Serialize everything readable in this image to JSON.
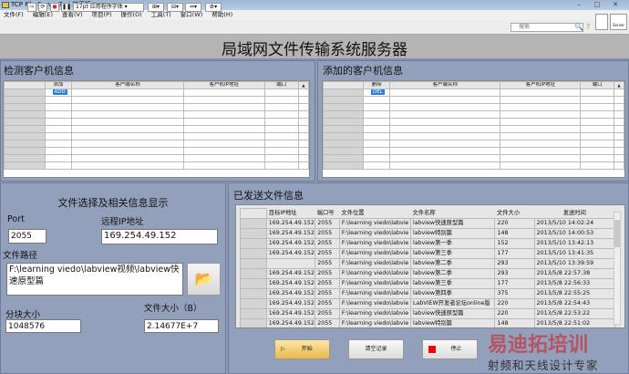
{
  "window": {
    "title": "TCP File Server7.vi 前面板 *",
    "minimize": "–",
    "maximize": "□",
    "close": "✕"
  },
  "menu": [
    "文件(F)",
    "编辑(E)",
    "查看(V)",
    "项目(P)",
    "操作(O)",
    "工具(T)",
    "窗口(W)",
    "帮助(H)"
  ],
  "toolbar": {
    "font": "17pt 应用程序字体",
    "search_placeholder": "搜索",
    "help": "?",
    "server_label": "Server"
  },
  "header": {
    "title": "局域网文件传输系统服务器"
  },
  "detected": {
    "title": "检测客户机信息",
    "columns": [
      "添加",
      "客户端名称",
      "客户机IP地址",
      "端口"
    ],
    "button": "ADD"
  },
  "added": {
    "title": "添加的客户机信息",
    "columns": [
      "删除",
      "客户端名称",
      "客户机IP地址",
      "端口"
    ],
    "button": "DEL"
  },
  "file_panel": {
    "title": "文件选择及相关信息显示",
    "port_label": "Port",
    "port": "2055",
    "ip_label": "远程IP地址",
    "ip": "169.254.49.152",
    "path_label": "文件路径",
    "path": "F:\\learning viedo\\labview视频\\labview快速原型篇",
    "chunk_label": "分块大小",
    "chunk": "1048576",
    "size_label": "文件大小（B）",
    "size": "2.14677E+7"
  },
  "sent": {
    "title": "已发送文件信息",
    "columns": [
      "目标IP地址",
      "端口号",
      "文件位置",
      "文件名称",
      "文件大小",
      "发送时间"
    ],
    "rows": [
      [
        "169.254.49.152",
        "2055",
        "F:\\learning viedo\\labvie",
        "labview快速原型篇",
        "220",
        "2013/5/10 14:02:24"
      ],
      [
        "169.254.49.152",
        "2055",
        "F:\\learning viedo\\labvie",
        "labview特别篇",
        "148",
        "2013/5/10 14:00:53"
      ],
      [
        "169.254.49.152",
        "2055",
        "F:\\learning viedo\\labvie",
        "labview第一季",
        "152",
        "2013/5/10 13:42:13"
      ],
      [
        "169.254.49.152",
        "2055",
        "F:\\learning viedo\\labvie",
        "labview第三季",
        "177",
        "2013/5/10 13:41:35"
      ],
      [
        "",
        "2055",
        "F:\\learning viedo\\labvie",
        "labview第二季",
        "293",
        "2013/5/10 13:39:59"
      ],
      [
        "169.254.49.152",
        "2055",
        "F:\\learning viedo\\labvie",
        "labview第二季",
        "293",
        "2013/5/8 22:57:38"
      ],
      [
        "169.254.49.152",
        "2055",
        "F:\\learning viedo\\labvie",
        "labview第三季",
        "177",
        "2013/5/8 22:56:33"
      ],
      [
        "169.254.49.152",
        "2055",
        "F:\\learning viedo\\labvie",
        "labview第四季",
        "375",
        "2013/5/8 22:55:25"
      ],
      [
        "169.254.49.152",
        "2055",
        "F:\\learning viedo\\labvie",
        "LabVIEW开发者论坛online版",
        "220",
        "2013/5/8 22:54:43"
      ],
      [
        "169.254.49.152",
        "2055",
        "F:\\learning viedo\\labvie",
        "labview快速原型篇",
        "220",
        "2013/5/8 22:53:22"
      ],
      [
        "169.254.49.152",
        "2055",
        "F:\\learning viedo\\labvie",
        "labview特别篇",
        "148",
        "2013/5/8 22:51:02"
      ]
    ]
  },
  "buttons": {
    "start": "开始",
    "clear": "清空记录",
    "stop": "停止"
  },
  "watermark": {
    "line1": "易迪拓培训",
    "line2": "射频和天线设计专家"
  }
}
